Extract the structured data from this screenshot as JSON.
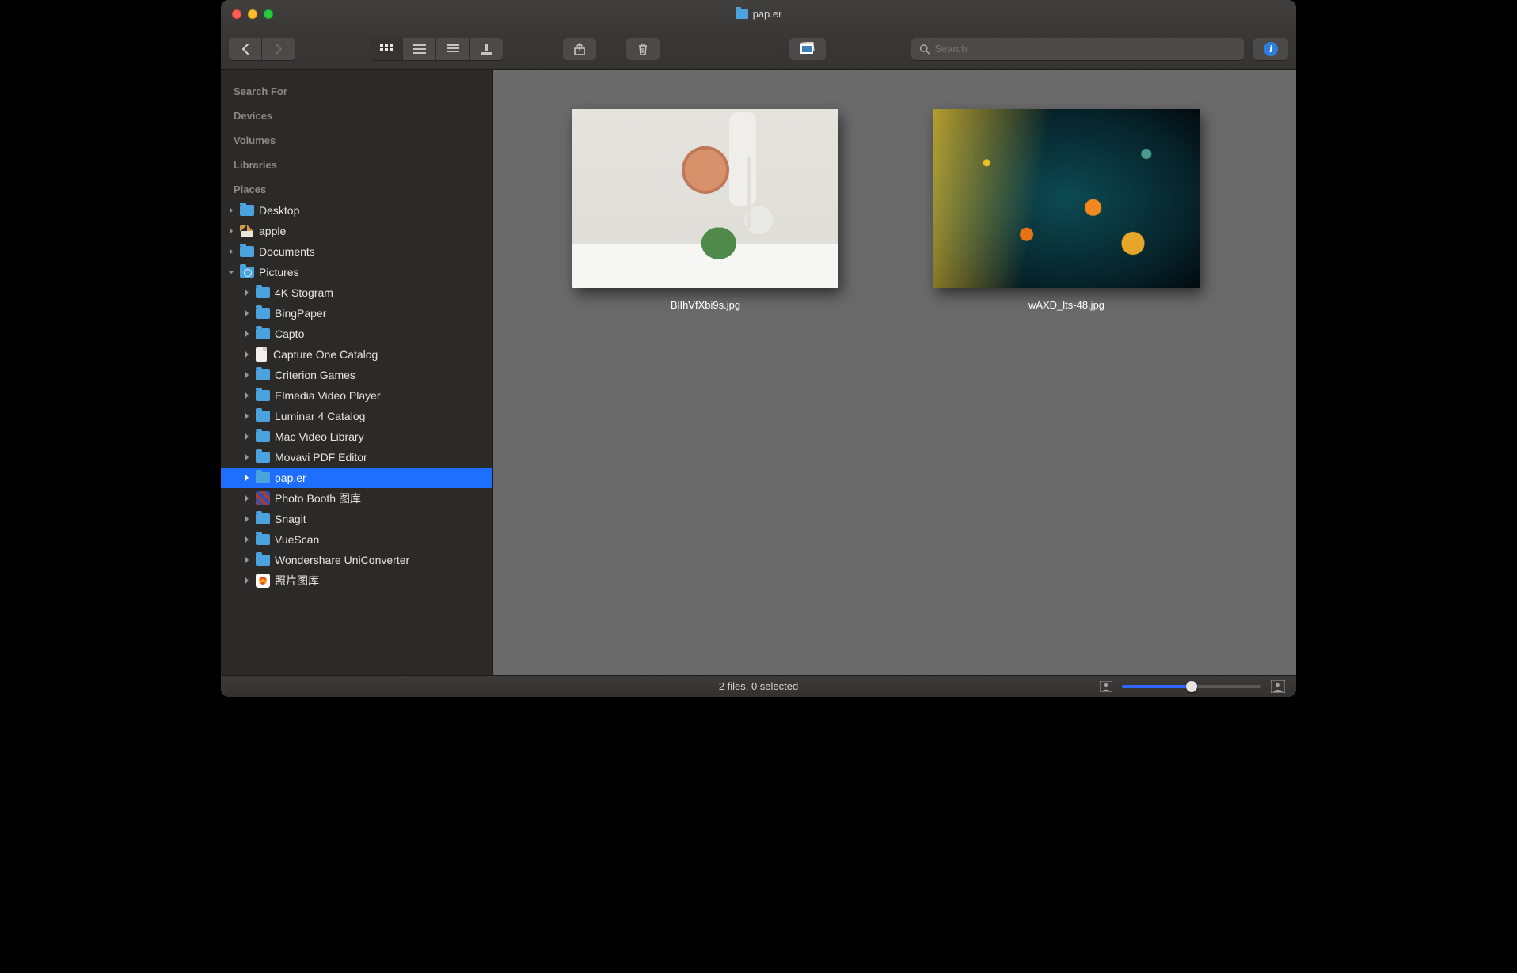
{
  "window": {
    "title": "pap.er"
  },
  "toolbar": {
    "search_placeholder": "Search"
  },
  "sidebar": {
    "headers": {
      "search_for": "Search For",
      "devices": "Devices",
      "volumes": "Volumes",
      "libraries": "Libraries",
      "places": "Places"
    },
    "places": [
      {
        "label": "Desktop",
        "icon": "folder",
        "indent": 0,
        "expanded": false
      },
      {
        "label": "apple",
        "icon": "house",
        "indent": 0,
        "expanded": false
      },
      {
        "label": "Documents",
        "icon": "folder",
        "indent": 0,
        "expanded": false
      },
      {
        "label": "Pictures",
        "icon": "camera",
        "indent": 0,
        "expanded": true
      },
      {
        "label": "4K Stogram",
        "icon": "folder",
        "indent": 1,
        "expanded": false
      },
      {
        "label": "BingPaper",
        "icon": "folder",
        "indent": 1,
        "expanded": false
      },
      {
        "label": "Capto",
        "icon": "folder",
        "indent": 1,
        "expanded": false
      },
      {
        "label": "Capture One Catalog",
        "icon": "file",
        "indent": 1,
        "expanded": false
      },
      {
        "label": "Criterion Games",
        "icon": "folder",
        "indent": 1,
        "expanded": false
      },
      {
        "label": "Elmedia Video Player",
        "icon": "folder",
        "indent": 1,
        "expanded": false
      },
      {
        "label": "Luminar 4 Catalog",
        "icon": "folder",
        "indent": 1,
        "expanded": false
      },
      {
        "label": "Mac Video Library",
        "icon": "folder",
        "indent": 1,
        "expanded": false
      },
      {
        "label": "Movavi PDF Editor",
        "icon": "folder",
        "indent": 1,
        "expanded": false
      },
      {
        "label": "pap.er",
        "icon": "folder",
        "indent": 1,
        "expanded": false,
        "selected": true
      },
      {
        "label": "Photo Booth 图库",
        "icon": "app",
        "indent": 1,
        "expanded": false
      },
      {
        "label": "Snagit",
        "icon": "folder",
        "indent": 1,
        "expanded": false
      },
      {
        "label": "VueScan",
        "icon": "folder",
        "indent": 1,
        "expanded": false
      },
      {
        "label": "Wondershare UniConverter",
        "icon": "folder",
        "indent": 1,
        "expanded": false
      },
      {
        "label": "照片图库",
        "icon": "flower",
        "indent": 1,
        "expanded": false
      }
    ]
  },
  "files": [
    {
      "name": "BlIhVfXbi9s.jpg",
      "thumb": "a"
    },
    {
      "name": "wAXD_lts-48.jpg",
      "thumb": "b"
    }
  ],
  "statusbar": {
    "text": "2 files, 0 selected",
    "slider_percent": 50
  }
}
